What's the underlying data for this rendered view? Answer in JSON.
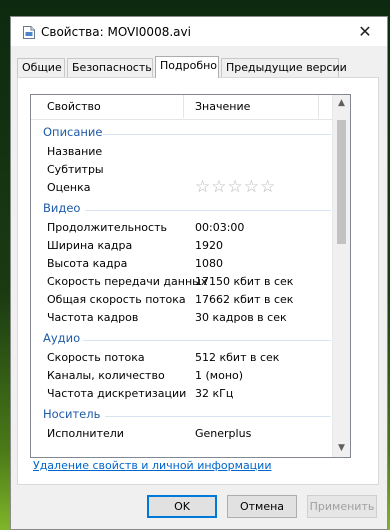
{
  "window": {
    "title": "Свойства: MOVI0008.avi",
    "close_glyph": "✕"
  },
  "tabs": [
    {
      "label": "Общие"
    },
    {
      "label": "Безопасность"
    },
    {
      "label": "Подробно",
      "active": true
    },
    {
      "label": "Предыдущие версии"
    }
  ],
  "list": {
    "columns": {
      "property": "Свойство",
      "value": "Значение"
    },
    "groups": {
      "description": "Описание",
      "video": "Видео",
      "audio": "Аудио",
      "media": "Носитель"
    },
    "rows": {
      "name": {
        "property": "Название",
        "value": ""
      },
      "subtitles": {
        "property": "Субтитры",
        "value": ""
      },
      "rating": {
        "property": "Оценка",
        "value": "☆☆☆☆☆"
      },
      "duration": {
        "property": "Продолжительность",
        "value": "00:03:00"
      },
      "frame_width": {
        "property": "Ширина кадра",
        "value": "1920"
      },
      "frame_height": {
        "property": "Высота кадра",
        "value": "1080"
      },
      "data_rate": {
        "property": "Скорость передачи данных",
        "value": "17150 кбит в сек"
      },
      "total_bitrate": {
        "property": "Общая скорость потока",
        "value": "17662 кбит в сек"
      },
      "frame_rate": {
        "property": "Частота кадров",
        "value": "30 кадров в сек"
      },
      "audio_bitrate": {
        "property": "Скорость потока",
        "value": "512 кбит в сек"
      },
      "channels": {
        "property": "Каналы, количество",
        "value": "1 (моно)"
      },
      "sample_rate": {
        "property": "Частота дискретизации",
        "value": "32 кГц"
      },
      "artists": {
        "property": "Исполнители",
        "value": "Generplus"
      }
    }
  },
  "remove_link": "Удаление свойств и личной информации",
  "buttons": {
    "ok": "OK",
    "cancel": "Отмена",
    "apply": "Применить"
  },
  "colors": {
    "group_text": "#1e5aa8",
    "link": "#0066cc",
    "primary_border": "#0078d7"
  }
}
